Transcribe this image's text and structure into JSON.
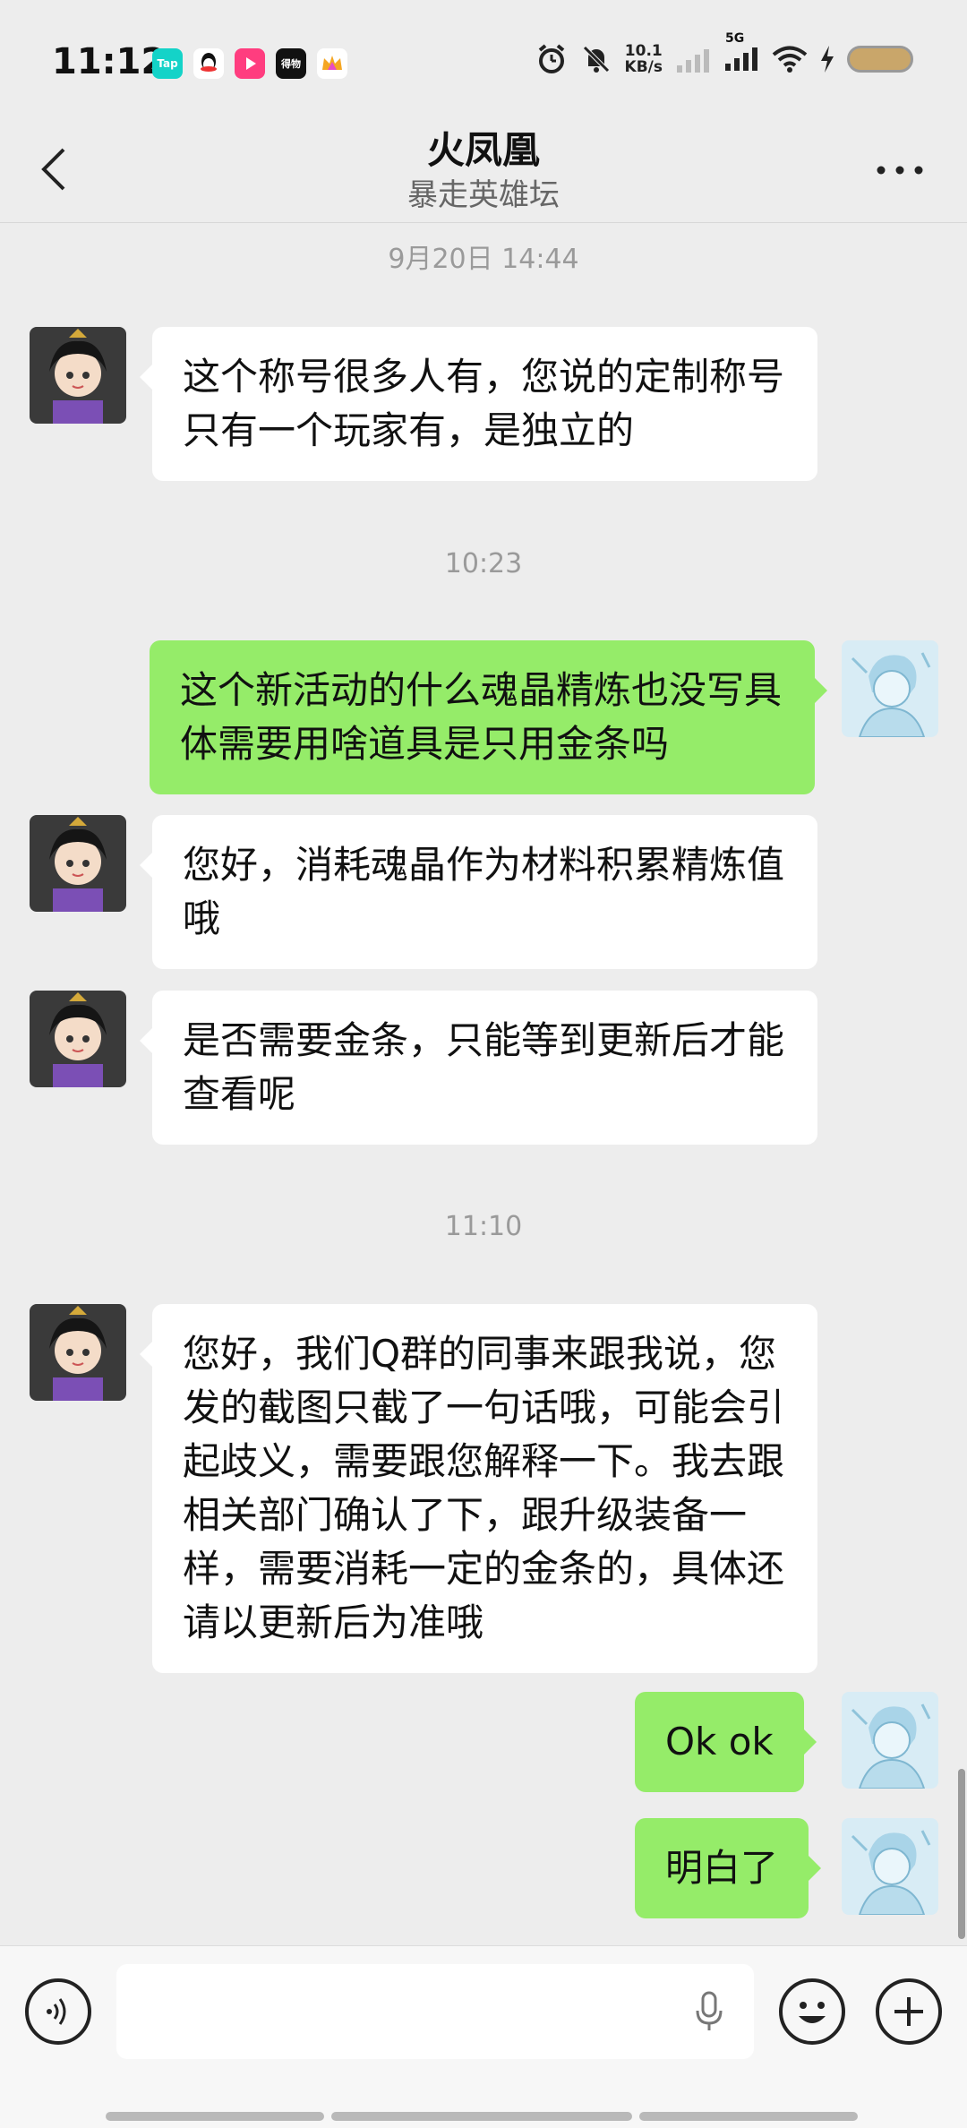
{
  "status_bar": {
    "time": "11:12",
    "apps": [
      {
        "name": "taptap-icon",
        "label": "Tap",
        "color": "#14d3c8"
      },
      {
        "name": "qq-icon",
        "label": "",
        "color": "#ffffff"
      },
      {
        "name": "video-app-icon",
        "label": "",
        "color": "#ff3d7f"
      },
      {
        "name": "dewu-app-icon",
        "label": "得物",
        "color": "#111111"
      },
      {
        "name": "crown-app-icon",
        "label": "",
        "color": "#ffffff"
      }
    ],
    "net_speed_value": "10.1",
    "net_speed_unit": "KB/s",
    "network_type": "5G"
  },
  "header": {
    "title": "火凤凰",
    "subtitle": "暴走英雄坛"
  },
  "timestamps": {
    "t1": "9月20日 14:44",
    "t2": "10:23",
    "t3": "11:10"
  },
  "messages": [
    {
      "side": "in",
      "text": "这个称号很多人有，您说的定制称号只有一个玩家有，是独立的"
    },
    {
      "side": "out",
      "text": "这个新活动的什么魂晶精炼也没写具体需要用啥道具是只用金条吗"
    },
    {
      "side": "in",
      "text": "您好，消耗魂晶作为材料积累精炼值哦"
    },
    {
      "side": "in",
      "text": "是否需要金条，只能等到更新后才能查看呢"
    },
    {
      "side": "in",
      "text": "您好，我们Q群的同事来跟我说，您发的截图只截了一句话哦，可能会引起歧义，需要跟您解释一下。我去跟相关部门确认了下，跟升级装备一样，需要消耗一定的金条的，具体还请以更新后为准哦"
    },
    {
      "side": "out",
      "text": "Ok ok"
    },
    {
      "side": "out",
      "text": "明白了"
    }
  ],
  "colors": {
    "out_bubble": "#95ec69",
    "in_bubble": "#ffffff",
    "background": "#ededed"
  }
}
